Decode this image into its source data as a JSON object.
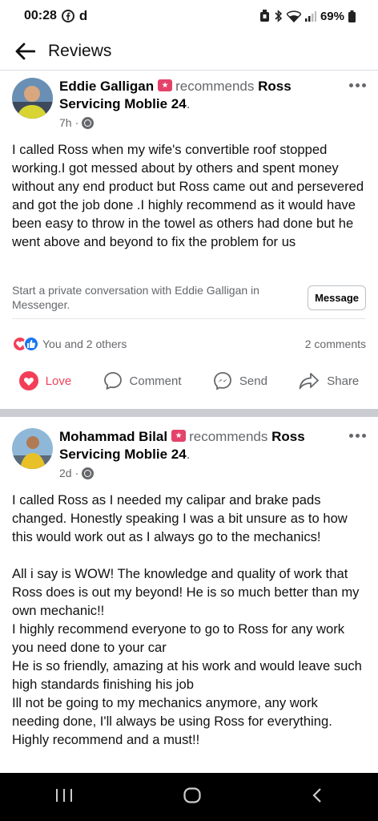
{
  "status_bar": {
    "time": "00:28",
    "extra": "d",
    "battery": "69%"
  },
  "header": {
    "title": "Reviews"
  },
  "reviews": [
    {
      "name": "Eddie Galligan",
      "verb": "recommends",
      "page": "Ross Servicing Moblie 24",
      "time": "7h",
      "body": "I called Ross when my wife's convertible roof stopped working.I got messed about by others and spent money without any end product but Ross came out and persevered and got the job done .I highly recommend as it would have been easy to throw in the towel as others had done but he went above and beyond to fix the problem for us",
      "private_msg": "Start a private conversation with Eddie Galligan in Messenger.",
      "message_button": "Message",
      "reactions_label": "You and 2 others",
      "comments_count": "2 comments",
      "actions": {
        "love": "Love",
        "comment": "Comment",
        "send": "Send",
        "share": "Share"
      },
      "avatar_colors": {
        "bg": "#6a8fb5",
        "shirt": "#d8d432"
      }
    },
    {
      "name": "Mohammad Bilal",
      "verb": "recommends",
      "page": "Ross Servicing Moblie 24",
      "time": "2d",
      "body": "I called Ross as I needed my calipar and brake pads changed. Honestly speaking I was a bit unsure as to how this would work out as I always go to the mechanics!\n\nAll i say is WOW! The knowledge and quality of work that Ross does is out my beyond! He is so much better than my own mechanic!!\nI highly recommend everyone to go to Ross for any work you need done to your car\nHe is so friendly, amazing at his work and would leave such high standards finishing his job\nIll not be going to my mechanics anymore, any work needing done, I'll always be using Ross for everything.\nHighly recommend and a must!!",
      "avatar_colors": {
        "bg": "#8fb8d8",
        "shirt": "#e8c028"
      }
    }
  ],
  "colors": {
    "love": "#f33e58",
    "like": "#1877f2",
    "secondary_text": "#65676b",
    "separator": "#c9ccd1"
  },
  "icons": {
    "back": "arrow-left-icon",
    "more": "more-dots-icon",
    "globe": "globe-icon",
    "love": "heart-icon",
    "comment": "comment-bubble-icon",
    "send": "messenger-icon",
    "share": "share-arrow-icon"
  }
}
